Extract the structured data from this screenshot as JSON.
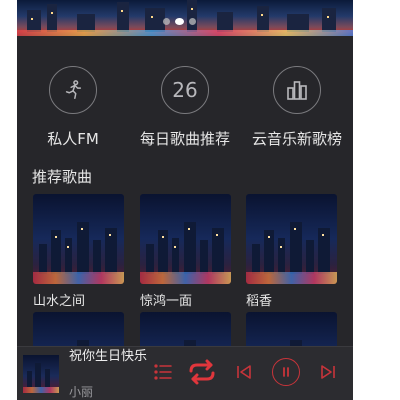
{
  "banner": {
    "dots_count": 3,
    "active_dot": 1
  },
  "entries": [
    {
      "label": "私人FM",
      "icon": "running-person-icon"
    },
    {
      "label": "每日歌曲推荐",
      "icon": "calendar-day-icon",
      "day": "26"
    },
    {
      "label": "云音乐新歌榜",
      "icon": "chart-bars-icon"
    }
  ],
  "section_title": "推荐歌曲",
  "songs": [
    {
      "title": "山水之间"
    },
    {
      "title": "惊鸿一面"
    },
    {
      "title": "稻香"
    },
    {
      "title": ""
    },
    {
      "title": ""
    },
    {
      "title": ""
    }
  ],
  "player": {
    "song_title": "祝你生日快乐",
    "artist": "小丽",
    "icons": [
      "playlist-icon",
      "repeat-icon",
      "previous-icon",
      "pause-icon",
      "next-icon"
    ],
    "accent_color": "#c8343a"
  },
  "colors": {
    "background": "#26262a",
    "text": "#e6e6e6",
    "accent": "#c8343a"
  }
}
